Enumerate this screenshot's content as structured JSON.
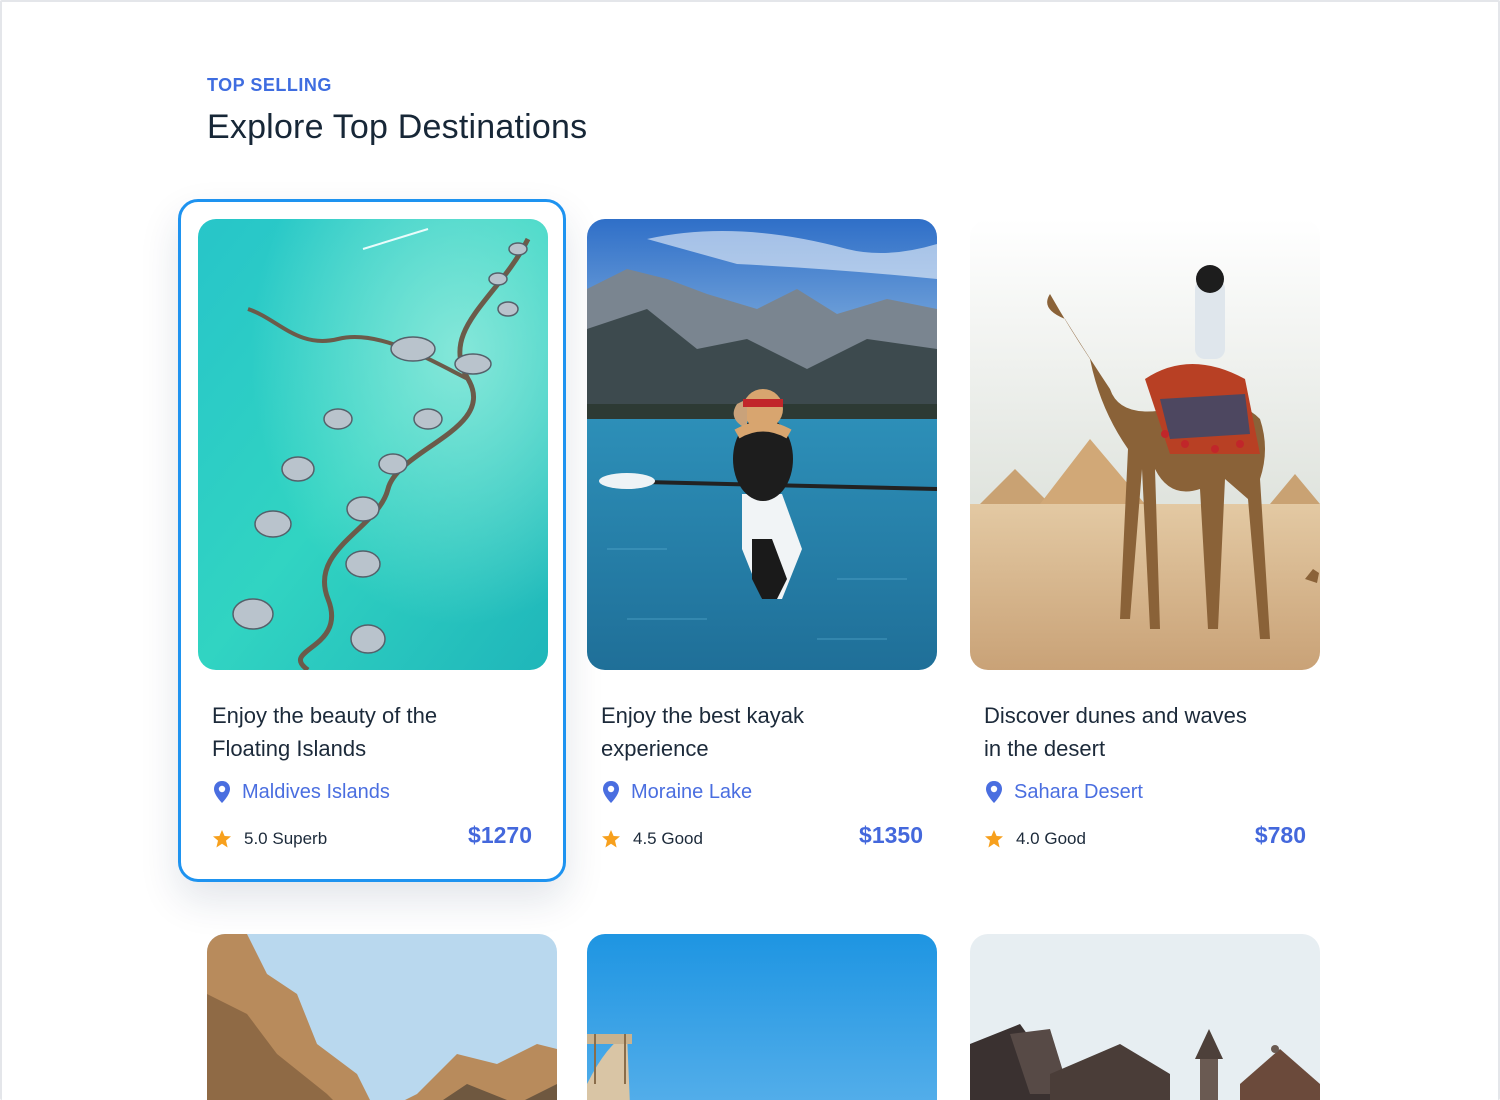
{
  "section": {
    "eyebrow": "TOP SELLING",
    "title": "Explore Top Destinations"
  },
  "colors": {
    "accent": "#3f6de0",
    "selected_border": "#1e93f0",
    "star": "#f7a01d",
    "price": "#4468dc"
  },
  "cards": [
    {
      "title_line1": "Enjoy the beauty of  the",
      "title_line2": "Floating Islands",
      "location": "Maldives Islands",
      "rating": "5.0 Superb",
      "price": "$1270",
      "selected": true,
      "image": "maldives-overwater-villas"
    },
    {
      "title_line1": "Enjoy the best kayak",
      "title_line2": "experience",
      "location": "Moraine Lake",
      "rating": "4.5 Good",
      "price": "$1350",
      "selected": false,
      "image": "kayak-mountain-lake"
    },
    {
      "title_line1": "Discover dunes and waves",
      "title_line2": "in the desert",
      "location": "Sahara Desert",
      "rating": "4.0 Good",
      "price": "$780",
      "selected": false,
      "image": "camel-pyramids-desert"
    }
  ],
  "next_row_images": [
    "rocky-cliffs",
    "blue-sky-coast",
    "rooftops-village"
  ]
}
